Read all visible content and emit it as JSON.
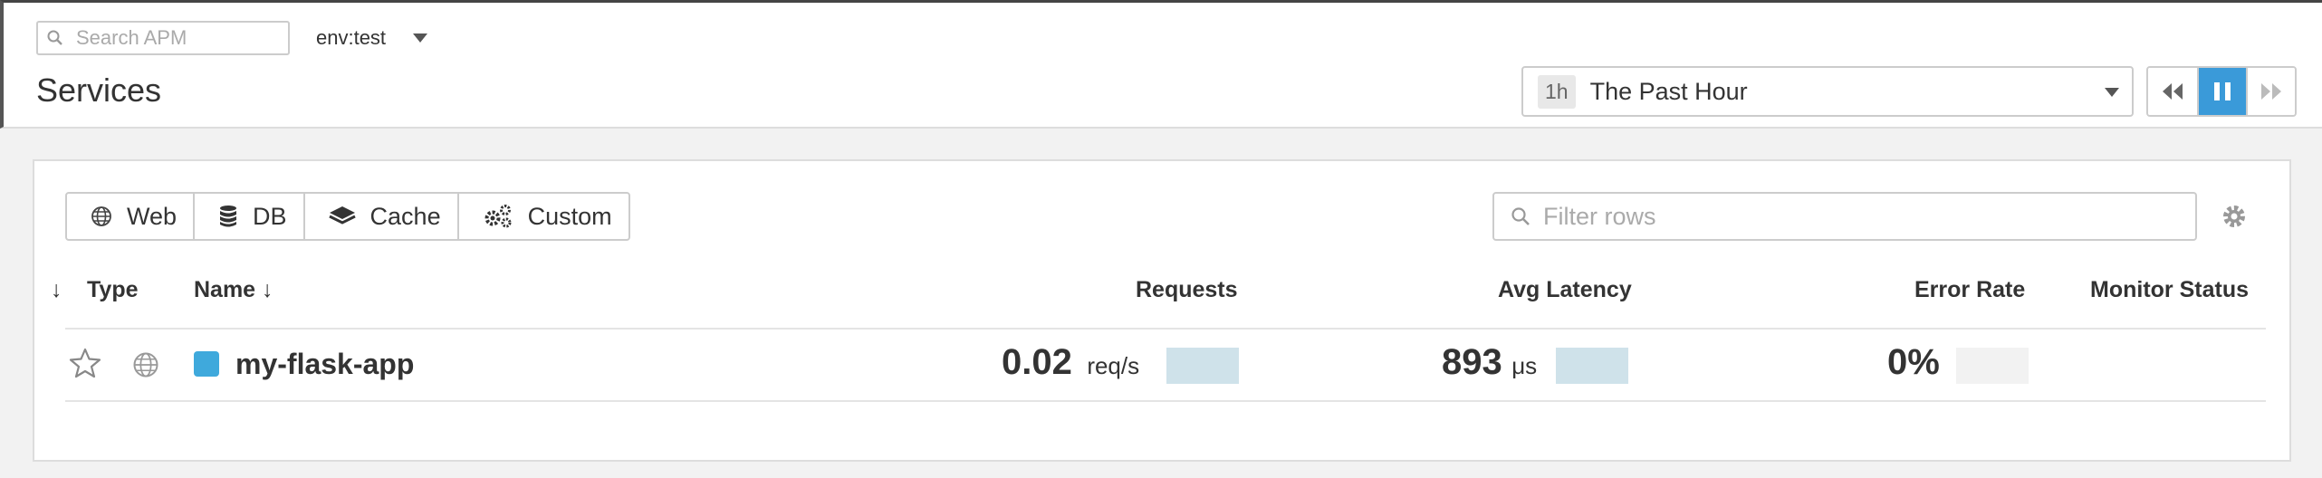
{
  "search": {
    "placeholder": "Search APM"
  },
  "env": {
    "label": "env:test"
  },
  "page_title": "Services",
  "timeframe": {
    "badge": "1h",
    "label": "The Past Hour"
  },
  "playback": {
    "buttons": [
      "rewind-icon",
      "pause-icon",
      "fast-forward-icon"
    ],
    "active": "pause-icon"
  },
  "type_filters": [
    {
      "label": "Web",
      "icon": "globe-icon"
    },
    {
      "label": "DB",
      "icon": "database-icon"
    },
    {
      "label": "Cache",
      "icon": "layers-icon"
    },
    {
      "label": "Custom",
      "icon": "gears-icon"
    }
  ],
  "filter_rows": {
    "placeholder": "Filter rows"
  },
  "columns": {
    "sort": "↓",
    "type": "Type",
    "name": "Name ↓",
    "requests": "Requests",
    "avg_latency": "Avg Latency",
    "error_rate": "Error Rate",
    "monitor_status": "Monitor Status"
  },
  "rows": [
    {
      "starred": false,
      "type_icon": "globe-icon",
      "color": "#3fa9dc",
      "name": "my-flask-app",
      "requests_value": "0.02",
      "requests_unit": "req/s",
      "latency_value": "893",
      "latency_unit": "μs",
      "error_rate": "0%",
      "monitor_status": ""
    }
  ],
  "colors": {
    "accent": "#3a9ad9",
    "sparkline": "#cfe2ea",
    "service": "#3fa9dc"
  }
}
